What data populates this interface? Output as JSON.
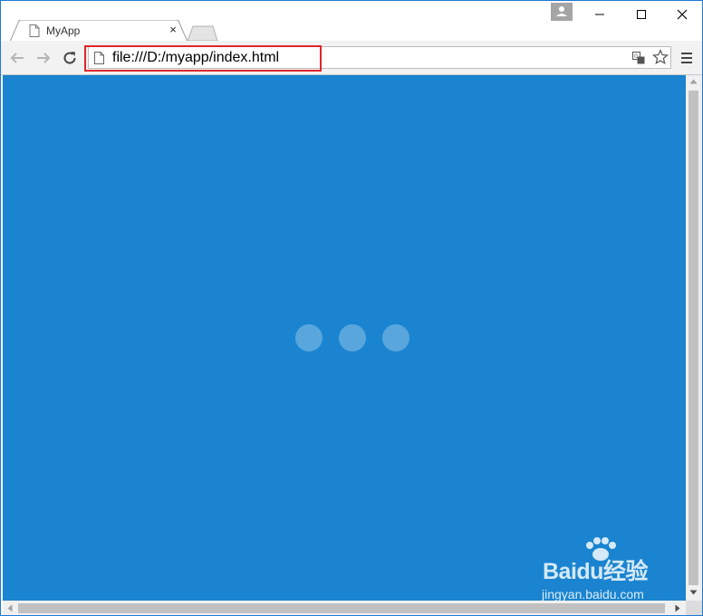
{
  "tab": {
    "title": "MyApp",
    "close_glyph": "×"
  },
  "address_bar": {
    "url": "file:///D:/myapp/index.html"
  },
  "window_controls": {
    "minimize_glyph": "—",
    "maximize_glyph": "☐",
    "close_glyph": "✕"
  },
  "page": {
    "background_color": "#1a84d0",
    "loader_dot_count": 3
  },
  "watermark": {
    "brand": "Baidu经验",
    "site": "jingyan.baidu.com"
  },
  "colors": {
    "highlight_box": "#e0262b",
    "window_border": "#1e7ad6"
  }
}
